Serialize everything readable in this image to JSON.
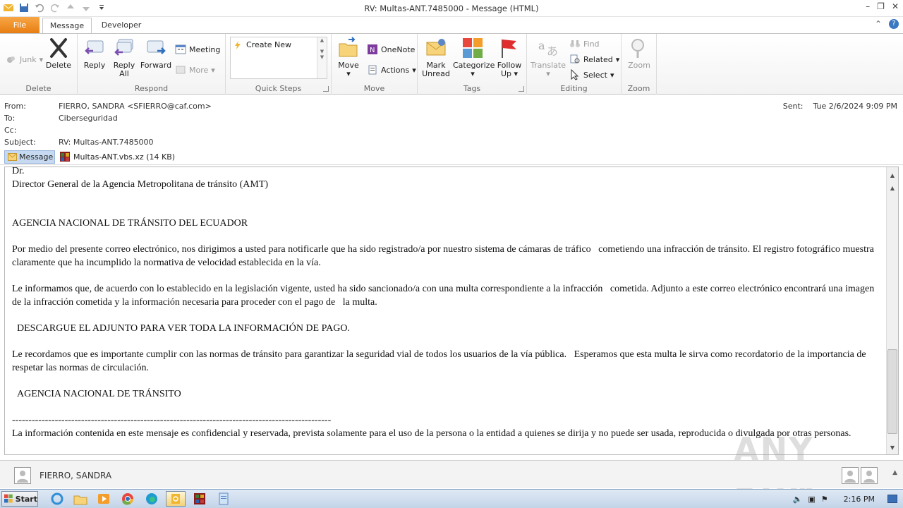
{
  "window": {
    "title": "RV: Multas-ANT.7485000  -  Message (HTML)"
  },
  "tabs": {
    "file": "File",
    "message": "Message",
    "developer": "Developer"
  },
  "ribbon": {
    "delete_group": {
      "label": "Delete",
      "junk": "Junk",
      "delete": "Delete"
    },
    "respond_group": {
      "label": "Respond",
      "reply": "Reply",
      "reply_all_1": "Reply",
      "reply_all_2": "All",
      "forward": "Forward",
      "meeting": "Meeting",
      "more": "More"
    },
    "quicksteps_group": {
      "label": "Quick Steps",
      "create_new": "Create New"
    },
    "move_group": {
      "label": "Move",
      "move": "Move",
      "onenote": "OneNote",
      "actions": "Actions"
    },
    "tags_group": {
      "label": "Tags",
      "mark_unread_1": "Mark",
      "mark_unread_2": "Unread",
      "categorize": "Categorize",
      "follow_up_1": "Follow",
      "follow_up_2": "Up"
    },
    "editing_group": {
      "label": "Editing",
      "translate": "Translate",
      "find": "Find",
      "related": "Related",
      "select": "Select"
    },
    "zoom_group": {
      "label": "Zoom",
      "zoom": "Zoom"
    }
  },
  "header": {
    "from_label": "From:",
    "from_value": "FIERRO, SANDRA <SFIERRO@caf.com>",
    "to_label": "To:",
    "to_value": "Ciberseguridad",
    "cc_label": "Cc:",
    "cc_value": "",
    "subject_label": "Subject:",
    "subject_value": "RV: Multas-ANT.7485000",
    "sent_label": "Sent:",
    "sent_value": "Tue 2/6/2024 9:09 PM"
  },
  "attachments": {
    "message_tab": "Message",
    "file": "Multas-ANT.vbs.xz (14 KB)"
  },
  "body": {
    "line_dr": "Dr.",
    "line_director": "Director General de la Agencia Metropolitana de tránsito (AMT)",
    "line_agency": "AGENCIA NACIONAL DE TRÁNSITO DEL ECUADOR",
    "para1": "Por medio del presente correo electrónico, nos dirigimos a usted para notificarle que ha sido registrado/a por nuestro sistema de cámaras de tráfico   cometiendo una infracción de tránsito. El registro fotográfico muestra claramente que ha incumplido la normativa de velocidad establecida en la vía.",
    "para2": "Le informamos que, de acuerdo con lo establecido en la legislación vigente, usted ha sido sancionado/a con una multa correspondiente a la infracción   cometida. Adjunto a este correo electrónico encontrará una imagen de la infracción cometida y la información necesaria para proceder con el pago de   la multa.",
    "download": "  DESCARGUE EL ADJUNTO PARA VER TODA LA INFORMACIÓN DE PAGO.",
    "para3": "Le recordamos que es importante cumplir con las normas de tránsito para garantizar la seguridad vial de todos los usuarios de la vía pública.   Esperamos que esta multa le sirva como recordatorio de la importancia de respetar las normas de circulación.",
    "signature": "  AGENCIA NACIONAL DE TRÁNSITO",
    "divider": "-------------------------------------------------------------------------------------------------",
    "disclaimer": "La información contenida en este mensaje es confidencial y reservada, prevista solamente para el uso de la persona o la entidad a quienes se dirija y no puede ser usada, reproducida o divulgada por otras personas."
  },
  "people_pane": {
    "name": "FIERRO, SANDRA"
  },
  "taskbar": {
    "start": "Start",
    "clock": "2:16 PM"
  },
  "watermark": "ANY RUN",
  "colors": {
    "file_tab": "#e77e12",
    "accent_blue": "#c6d9f1"
  }
}
